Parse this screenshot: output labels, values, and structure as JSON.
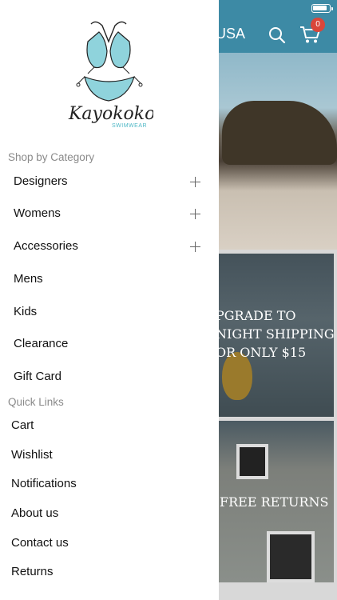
{
  "header": {
    "region": "USA",
    "cart_count": "0"
  },
  "banners": {
    "shipping_lines": [
      "PGRADE TO",
      "NIGHT SHIPPING",
      "OR ONLY $15"
    ],
    "returns": "FREE RETURNS"
  },
  "logo": {
    "brand": "Kayokoko",
    "tagline": "SWIMWEAR",
    "accent_color": "#4fb8c6"
  },
  "drawer": {
    "shop_title": "Shop by Category",
    "categories": [
      {
        "label": "Designers",
        "expandable": true
      },
      {
        "label": "Womens",
        "expandable": true
      },
      {
        "label": "Accessories",
        "expandable": true
      },
      {
        "label": "Mens",
        "expandable": false
      },
      {
        "label": "Kids",
        "expandable": false
      },
      {
        "label": "Clearance",
        "expandable": false
      },
      {
        "label": "Gift Card",
        "expandable": false
      }
    ],
    "quick_title": "Quick Links",
    "quick_links": [
      {
        "label": "Cart"
      },
      {
        "label": "Wishlist"
      },
      {
        "label": "Notifications"
      },
      {
        "label": "About us"
      },
      {
        "label": "Contact us"
      },
      {
        "label": "Returns"
      }
    ]
  },
  "colors": {
    "header_bar": "#3d8aa5",
    "badge": "#d9463a"
  }
}
